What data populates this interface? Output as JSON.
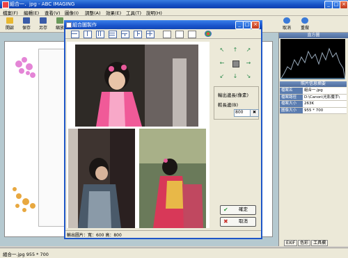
{
  "app": {
    "title": "組合一．jpg - ABC IMAGING",
    "window_buttons": {
      "minimize": "_",
      "maximize": "□",
      "close": "×"
    }
  },
  "menu": [
    "檔案(F)",
    "編輯(E)",
    "查看(V)",
    "圖像(I)",
    "調整(A)",
    "效果(E)",
    "工具(T)",
    "說明(H)"
  ],
  "toolbar": [
    {
      "label": "開啟",
      "icon": "folder-icon",
      "color": "#e8b830"
    },
    {
      "label": "保存",
      "icon": "save-icon",
      "color": "#3a5ca8"
    },
    {
      "label": "另存",
      "icon": "save-as-icon",
      "color": "#3a5ca8"
    },
    {
      "label": "縮放",
      "icon": "zoom-icon",
      "color": "#6a9a5a"
    },
    {
      "label": "取消",
      "icon": "undo-icon",
      "color": "#3a7ad8"
    },
    {
      "label": "重做",
      "icon": "redo-icon",
      "color": "#3a7ad8"
    }
  ],
  "right_panel": {
    "histogram_title": "直方圖",
    "info_title": "照片信息摘要",
    "info_rows": [
      {
        "key": "檔案名",
        "value": "組合一.jpg"
      },
      {
        "key": "檔案路徑",
        "value": "D:\\Canon\\光影魔手\\"
      },
      {
        "key": "檔案大小",
        "value": "263K"
      },
      {
        "key": "圖像大小",
        "value": "955 * 700"
      }
    ],
    "tabs": [
      "EXIF",
      "色彩",
      "工具欄"
    ]
  },
  "status": {
    "text": "組合一.jpg    955 * 700"
  },
  "dialog": {
    "title": "組合圖製作",
    "layout_buttons": 13,
    "settings": {
      "border_label": "輸出邊長(像素)",
      "long_side_label": "較長邊(B)",
      "long_side_value": "800",
      "check_symbol": "✖"
    },
    "arrows": [
      "↖",
      "↑",
      "↗",
      "←",
      "",
      "→",
      "↙",
      "↓",
      "↘"
    ],
    "ok_label": "確定",
    "cancel_label": "取消",
    "ok_icon": "✔",
    "cancel_icon": "✖",
    "status_text": "輸出圖片：寬：600  高：800"
  },
  "colors": {
    "accent": "#1650c4",
    "panel_header": "#5a7cb0"
  }
}
